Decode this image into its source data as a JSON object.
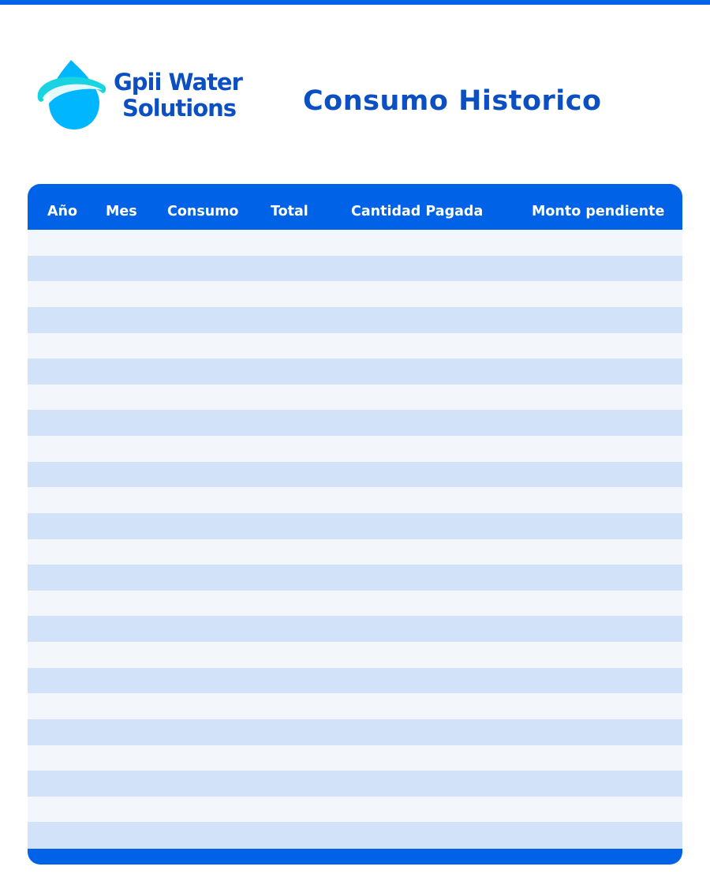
{
  "brand": {
    "name_line1": "Gpii Water",
    "name_line2": "Solutions",
    "colors": {
      "primary": "#0062e6",
      "text": "#0b4fc2",
      "drop": "#00b7ff",
      "ring": "#19d4e0"
    },
    "logo_icon": "water-drop-icon"
  },
  "document": {
    "title": "Consumo Historico"
  },
  "table": {
    "columns": [
      "Año",
      "Mes",
      "Consumo",
      "Total",
      "Cantidad Pagada",
      "Monto pendiente"
    ],
    "rows": [
      [
        "",
        "",
        "",
        "",
        "",
        ""
      ],
      [
        "",
        "",
        "",
        "",
        "",
        ""
      ],
      [
        "",
        "",
        "",
        "",
        "",
        ""
      ],
      [
        "",
        "",
        "",
        "",
        "",
        ""
      ],
      [
        "",
        "",
        "",
        "",
        "",
        ""
      ],
      [
        "",
        "",
        "",
        "",
        "",
        ""
      ],
      [
        "",
        "",
        "",
        "",
        "",
        ""
      ],
      [
        "",
        "",
        "",
        "",
        "",
        ""
      ],
      [
        "",
        "",
        "",
        "",
        "",
        ""
      ],
      [
        "",
        "",
        "",
        "",
        "",
        ""
      ],
      [
        "",
        "",
        "",
        "",
        "",
        ""
      ],
      [
        "",
        "",
        "",
        "",
        "",
        ""
      ],
      [
        "",
        "",
        "",
        "",
        "",
        ""
      ],
      [
        "",
        "",
        "",
        "",
        "",
        ""
      ],
      [
        "",
        "",
        "",
        "",
        "",
        ""
      ],
      [
        "",
        "",
        "",
        "",
        "",
        ""
      ],
      [
        "",
        "",
        "",
        "",
        "",
        ""
      ],
      [
        "",
        "",
        "",
        "",
        "",
        ""
      ],
      [
        "",
        "",
        "",
        "",
        "",
        ""
      ],
      [
        "",
        "",
        "",
        "",
        "",
        ""
      ],
      [
        "",
        "",
        "",
        "",
        "",
        ""
      ],
      [
        "",
        "",
        "",
        "",
        "",
        ""
      ],
      [
        "",
        "",
        "",
        "",
        "",
        ""
      ],
      [
        "",
        "",
        "",
        "",
        "",
        ""
      ]
    ],
    "row_colors": {
      "odd": "#f3f7fc",
      "even": "#d2e2f9"
    }
  }
}
